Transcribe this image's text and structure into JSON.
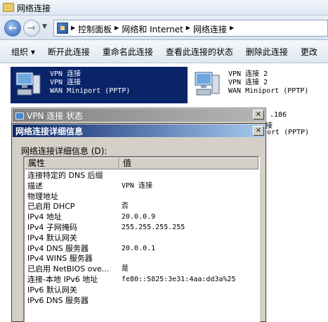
{
  "window": {
    "title": "网络连接"
  },
  "address": {
    "crumbs": [
      "控制面板",
      "网络和 Internet",
      "网络连接"
    ]
  },
  "toolbar": {
    "items": [
      "组织 ▾",
      "断开此连接",
      "重命名此连接",
      "查看此连接的状态",
      "删除此连接",
      "更改"
    ]
  },
  "connections": [
    {
      "name": "VPN 连接",
      "line2": "VPN 连接",
      "device": "WAN Miniport (PPTP)",
      "selected": true
    },
    {
      "name": "VPN 连接 2",
      "line2": "VPN 连接 2",
      "device": "WAN Miniport (PPTP)",
      "selected": false
    }
  ],
  "behind": {
    "ip": ".186",
    "frag": "接",
    "device": "ort (PPTP)"
  },
  "status_dialog": {
    "title": "VPN 连接 状态",
    "close": "×"
  },
  "details_dialog": {
    "title": "网络连接详细信息",
    "label": "网络连接详细信息 (D):",
    "close": "×",
    "columns": [
      "属性",
      "值"
    ],
    "rows": [
      {
        "k": "连接特定的 DNS 后缀",
        "v": ""
      },
      {
        "k": "描述",
        "v": "VPN 连接"
      },
      {
        "k": "物理地址",
        "v": ""
      },
      {
        "k": "已启用 DHCP",
        "v": "否"
      },
      {
        "k": "IPv4 地址",
        "v": "20.0.0.9"
      },
      {
        "k": "IPv4 子网掩码",
        "v": "255.255.255.255"
      },
      {
        "k": "IPv4 默认网关",
        "v": ""
      },
      {
        "k": "IPv4 DNS 服务器",
        "v": "20.0.0.1"
      },
      {
        "k": "IPv4 WINS 服务器",
        "v": ""
      },
      {
        "k": "已启用 NetBIOS ove...",
        "v": "是"
      },
      {
        "k": "连接-本地 IPv6 地址",
        "v": "fe80::5825:3e31:4aa:dd3a%25"
      },
      {
        "k": "IPv6 默认网关",
        "v": ""
      },
      {
        "k": "IPv6 DNS 服务器",
        "v": ""
      }
    ]
  },
  "icons": [
    "folder-icon",
    "back-arrow-icon",
    "forward-arrow-icon",
    "control-panel-icon",
    "network-computer-icon",
    "close-icon"
  ]
}
